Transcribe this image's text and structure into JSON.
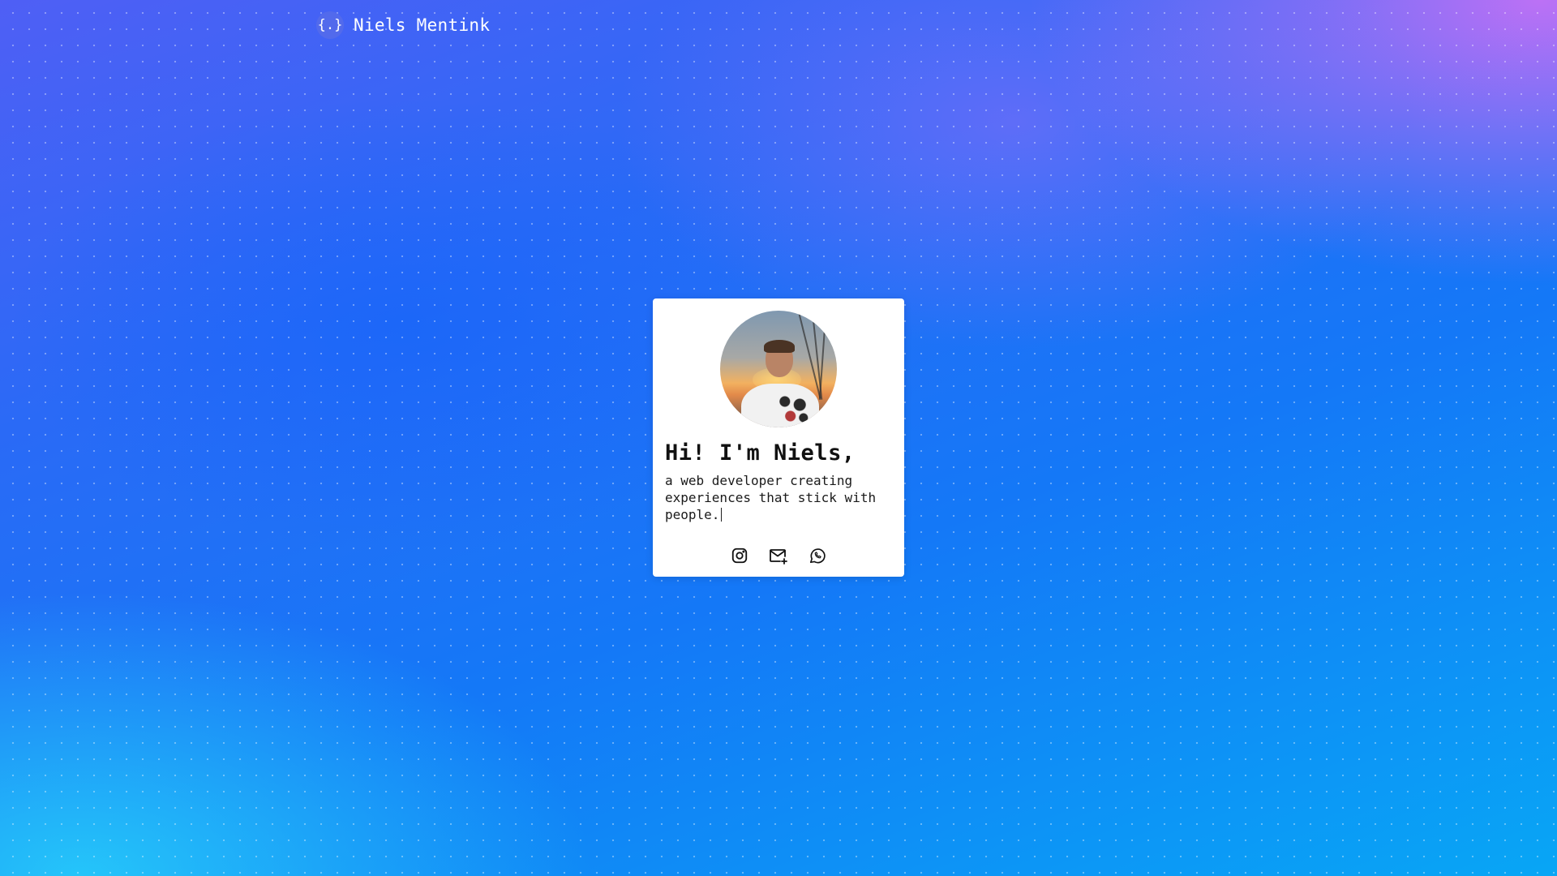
{
  "header": {
    "logo_glyph": "{.}",
    "site_name": "Niels Mentink"
  },
  "card": {
    "avatar_alt": "Portrait of Niels at sunset",
    "heading": "Hi! I'm Niels,",
    "description": "a web developer creating experiences that stick with people.",
    "social": [
      {
        "icon": "instagram-icon"
      },
      {
        "icon": "mail-plus-icon"
      },
      {
        "icon": "whatsapp-icon"
      }
    ]
  },
  "colors": {
    "card_background": "#ffffff",
    "text": "#111111",
    "gradient_top_right": "#c471f5",
    "gradient_mid": "#1478f7",
    "gradient_bottom_left": "#28d2fa"
  }
}
